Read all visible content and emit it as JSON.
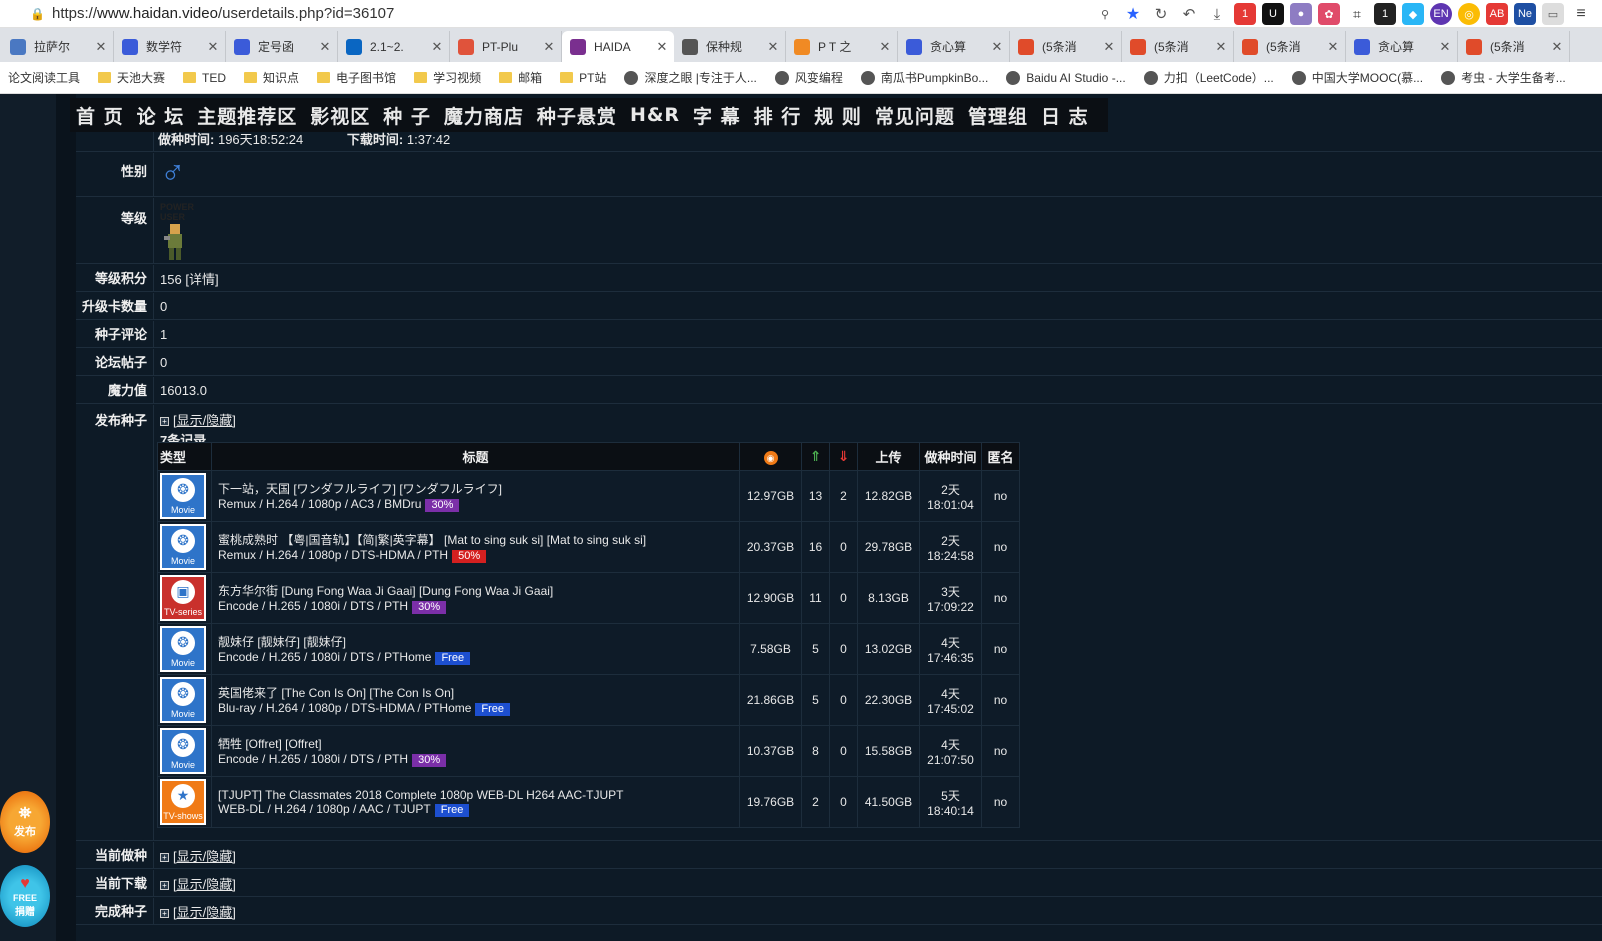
{
  "browser": {
    "url_prefix": "https://",
    "url_host": "www.haidan.video",
    "url_path": "/userdetails.php?id=36107",
    "tabs": [
      {
        "label": "拉萨尔",
        "icon_color": "#4a78c2"
      },
      {
        "label": "数学符",
        "icon_color": "#3b5bd9"
      },
      {
        "label": "定号函",
        "icon_color": "#3b5bd9"
      },
      {
        "label": "2.1~2.",
        "icon_color": "#0a66c2"
      },
      {
        "label": "PT-Plu",
        "icon_color": "#e0533b"
      },
      {
        "label": "HAIDA",
        "icon_color": "#7a2f8f"
      },
      {
        "label": "保种规",
        "icon_color": "#555555"
      },
      {
        "label": "P T 之",
        "icon_color": "#f08a24"
      },
      {
        "label": "贪心算",
        "icon_color": "#3b5bd9"
      },
      {
        "label": "(5条消",
        "icon_color": "#e04b2a"
      },
      {
        "label": "(5条消",
        "icon_color": "#e04b2a"
      },
      {
        "label": "(5条消",
        "icon_color": "#e04b2a"
      },
      {
        "label": "贪心算",
        "icon_color": "#3b5bd9"
      },
      {
        "label": "(5条消",
        "icon_color": "#e04b2a"
      }
    ],
    "active_tab": 5,
    "close_glyph": "✕",
    "bookmarks": [
      {
        "label": "论文阅读工具",
        "kind": "none"
      },
      {
        "label": "天池大赛",
        "kind": "folder"
      },
      {
        "label": "TED",
        "kind": "folder"
      },
      {
        "label": "知识点",
        "kind": "folder"
      },
      {
        "label": "电子图书馆",
        "kind": "folder"
      },
      {
        "label": "学习视频",
        "kind": "folder"
      },
      {
        "label": "邮箱",
        "kind": "folder"
      },
      {
        "label": "PT站",
        "kind": "folder"
      },
      {
        "label": "深度之眼 |专注于人...",
        "kind": "icon"
      },
      {
        "label": "风变编程",
        "kind": "icon"
      },
      {
        "label": "南瓜书PumpkinBo...",
        "kind": "icon"
      },
      {
        "label": "Baidu AI Studio -...",
        "kind": "icon"
      },
      {
        "label": "力扣（LeetCode）...",
        "kind": "icon"
      },
      {
        "label": "中国大学MOOC(慕...",
        "kind": "icon"
      },
      {
        "label": "考虫 - 大学生备考...",
        "kind": "icon"
      }
    ]
  },
  "nav": [
    "首 页",
    "论 坛",
    "主题推荐区",
    "影视区",
    "种 子",
    "魔力商店",
    "种子悬赏",
    "H&R",
    "字 幕",
    "排 行",
    "规 则",
    "常见问题",
    "管理组",
    "日 志"
  ],
  "profile": {
    "seed_time_label": "做种时间:",
    "seed_time_value": "196天18:52:24",
    "download_time_label": "下载时间:",
    "download_time_value": "1:37:42",
    "gender_label": "性别",
    "gender_symbol": "♂",
    "level_label": "等级",
    "level_name": "POWER USER",
    "points_label": "等级积分",
    "points_value": "156",
    "points_detail": "[详情]",
    "upgrade_label": "升级卡数量",
    "upgrade_value": "0",
    "comments_label": "种子评论",
    "comments_value": "1",
    "posts_label": "论坛帖子",
    "posts_value": "0",
    "magic_label": "魔力值",
    "magic_value": "16013.0",
    "published_label": "发布种子",
    "toggle_text": "[显示/隐藏]",
    "record_count": "7条记录",
    "seeding_label": "当前做种",
    "downloading_label": "当前下载",
    "completed_label": "完成种子"
  },
  "table": {
    "headers": [
      "类型",
      "标题",
      "",
      "",
      "",
      "上传",
      "做种时间",
      "匿名"
    ],
    "rows": [
      {
        "cat": "movie",
        "cat_label": "Movie",
        "title": "下一站，天国 [ワンダフルライフ] [ワンダフルライフ]",
        "sub": "Remux / H.264 / 1080p / AC3 / BMDru",
        "tag": "30%",
        "tag_class": "p30",
        "size": "12.97GB",
        "seeders": "13",
        "leechers": "2",
        "uploaded": "12.82GB",
        "days": "2天",
        "time": "18:01:04",
        "anon": "no"
      },
      {
        "cat": "movie",
        "cat_label": "Movie",
        "title": "蜜桃成熟时 【粤|国音轨】【简|繁|英字幕】 [Mat to sing suk si] [Mat to sing suk si]",
        "sub": "Remux / H.264 / 1080p / DTS-HDMA / PTH",
        "tag": "50%",
        "tag_class": "p50",
        "size": "20.37GB",
        "seeders": "16",
        "leechers": "0",
        "uploaded": "29.78GB",
        "days": "2天",
        "time": "18:24:58",
        "anon": "no"
      },
      {
        "cat": "tv",
        "cat_label": "TV-series",
        "title": "东方华尔街 [Dung Fong Waa Ji Gaai] [Dung Fong Waa Ji Gaai]",
        "sub": "Encode / H.265 / 1080i / DTS / PTH",
        "tag": "30%",
        "tag_class": "p30",
        "size": "12.90GB",
        "seeders": "11",
        "leechers": "0",
        "uploaded": "8.13GB",
        "days": "3天",
        "time": "17:09:22",
        "anon": "no"
      },
      {
        "cat": "movie",
        "cat_label": "Movie",
        "title": "靓妹仔 [靓妹仔] [靓妹仔]",
        "sub": "Encode / H.265 / 1080i / DTS / PTHome",
        "tag": "Free",
        "tag_class": "free",
        "size": "7.58GB",
        "seeders": "5",
        "leechers": "0",
        "uploaded": "13.02GB",
        "days": "4天",
        "time": "17:46:35",
        "anon": "no"
      },
      {
        "cat": "movie",
        "cat_label": "Movie",
        "title": "英国佬来了 [The Con Is On] [The Con Is On]",
        "sub": "Blu-ray / H.264 / 1080p / DTS-HDMA / PTHome",
        "tag": "Free",
        "tag_class": "free",
        "size": "21.86GB",
        "seeders": "5",
        "leechers": "0",
        "uploaded": "22.30GB",
        "days": "4天",
        "time": "17:45:02",
        "anon": "no"
      },
      {
        "cat": "movie",
        "cat_label": "Movie",
        "title": "牺牲 [Offret] [Offret]",
        "sub": "Encode / H.265 / 1080i / DTS / PTH",
        "tag": "30%",
        "tag_class": "p30",
        "size": "10.37GB",
        "seeders": "8",
        "leechers": "0",
        "uploaded": "15.58GB",
        "days": "4天",
        "time": "21:07:50",
        "anon": "no"
      },
      {
        "cat": "show",
        "cat_label": "TV-shows",
        "title": "[TJUPT] The Classmates 2018 Complete 1080p WEB-DL H264 AAC-TJUPT",
        "sub": "WEB-DL / H.264 / 1080p / AAC / TJUPT",
        "tag": "Free",
        "tag_class": "free",
        "size": "19.76GB",
        "seeders": "2",
        "leechers": "0",
        "uploaded": "41.50GB",
        "days": "5天",
        "time": "18:40:14",
        "anon": "no"
      }
    ]
  },
  "float": {
    "publish": "发布",
    "free_top": "FREE",
    "free_bottom": "捐赠"
  }
}
